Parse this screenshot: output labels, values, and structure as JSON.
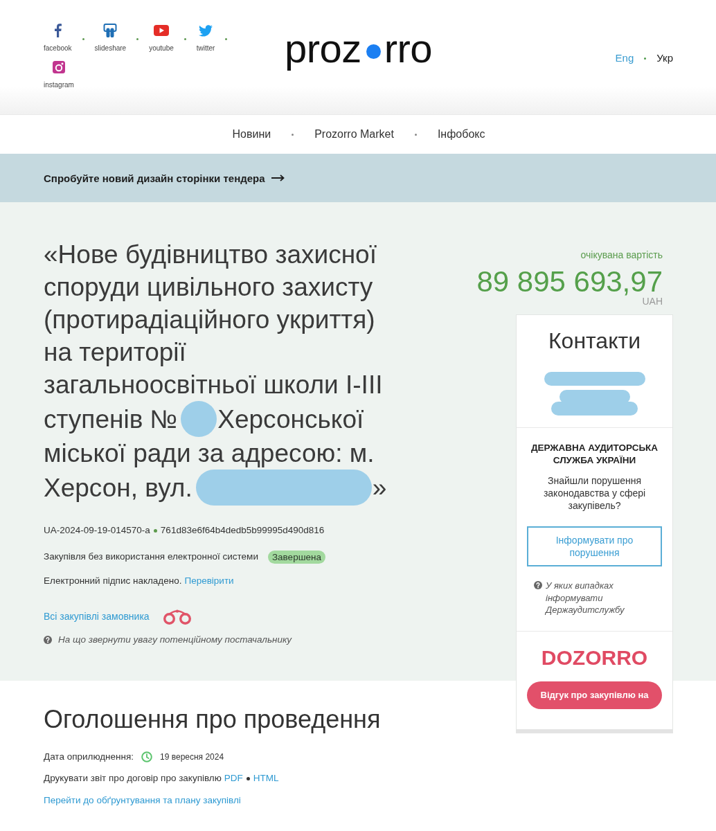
{
  "header": {
    "social_links": [
      {
        "label": "facebook",
        "kind": "facebook"
      },
      {
        "label": "slideshare",
        "kind": "slideshare"
      },
      {
        "label": "youtube",
        "kind": "youtube"
      },
      {
        "label": "twitter",
        "kind": "twitter"
      },
      {
        "label": "instagram",
        "kind": "instagram"
      }
    ],
    "logo": {
      "before_dot": "proz",
      "after_dot": "rro"
    },
    "languages": [
      {
        "label": "Eng",
        "selected": false
      },
      {
        "label": "Укр",
        "selected": true
      }
    ]
  },
  "nav": {
    "items": [
      "Новини",
      "Prozorro Market",
      "Інфобокс"
    ]
  },
  "banner": {
    "text": "Спробуйте новий дизайн сторінки тендера"
  },
  "tender": {
    "title": [
      {
        "kind": "text",
        "text": "«Нове будівництво захисної споруди цивільного захисту (протирадіаційного укриття) на території загальноосвітньої школи I-III"
      },
      {
        "kind": "text",
        "text": "ступенів №"
      },
      {
        "kind": "redaction"
      },
      {
        "kind": "text",
        "text": "Херсонської"
      },
      {
        "kind": "text",
        "text": "міської ради за адресою: м."
      },
      {
        "kind": "text",
        "text": "Херсон, вул."
      },
      {
        "kind": "redaction"
      },
      {
        "kind": "text",
        "text": "»"
      }
    ],
    "identifiers": [
      "UA-2024-09-19-014570-a",
      "761d83e6f64b4dedb5b99995d490d816"
    ],
    "procedure": {
      "text": "Закупівля без використання електронної системи",
      "status": "Завершена"
    },
    "signature": {
      "text": "Електронний підпис накладено.",
      "link": "Перевірити"
    },
    "buyer_link": "Всі закупівлі замовника",
    "hint": "На що звернути увагу потенційному постачальнику"
  },
  "value": {
    "label": "очікувана вартість",
    "amount": "89 895 693,97",
    "currency": "UAH"
  },
  "sidebar": {
    "contacts": {
      "heading": "Контакти",
      "lines": [
        {
          "kind": "redaction"
        },
        {
          "kind": "redaction"
        },
        {
          "kind": "redaction"
        }
      ]
    },
    "audit": {
      "heading": "ДЕРЖАВНА АУДИТОРСЬКА СЛУЖБА УКРАЇНИ",
      "question": "Знайшли порушення законодавства у сфері закупівель?",
      "button": "Інформувати про порушення",
      "hint": "У яких випадках інформувати Держаудитслужбу"
    },
    "dozorro": {
      "logo": "DOZORRO",
      "button": "Відгук про закупівлю на"
    }
  },
  "announcement": {
    "heading": "Оголошення про проведення",
    "published_label": "Дата оприлюднення:",
    "published_date": "19 вересня 2024",
    "print_text": "Друкувати звіт про договір про закупівлю",
    "print_links": [
      "PDF",
      "HTML"
    ],
    "plan_link": "Перейти до обґрунтування та плану закупівлі"
  }
}
